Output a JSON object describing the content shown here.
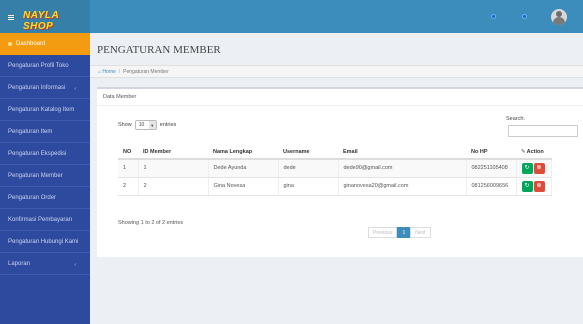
{
  "brand": {
    "logo_text": "NAYLA SHOP"
  },
  "sidebar": {
    "items": [
      {
        "label": "Dashboard",
        "active": true
      },
      {
        "label": "Pengaturan Profil Toko"
      },
      {
        "label": "Pengaturan Informasi",
        "caret": "‹"
      },
      {
        "label": "Pengaturan Katalog Item"
      },
      {
        "label": "Pengaturan Item"
      },
      {
        "label": "Pengaturan Ekspedisi"
      },
      {
        "label": "Pengaturan Member"
      },
      {
        "label": "Pengaturan Order"
      },
      {
        "label": "Konfirmasi Pembayaran"
      },
      {
        "label": "Pengaturan Hubungi Kami"
      },
      {
        "label": "Laporan",
        "caret": "‹"
      }
    ]
  },
  "page": {
    "title": "PENGATURAN MEMBER",
    "breadcrumb": {
      "home": "Home",
      "current": "Pengaturan Member"
    }
  },
  "box": {
    "header": "Data Member",
    "show_label": "Show",
    "entries_value": "10",
    "entries_label": "entries",
    "search_label": "Search:"
  },
  "table": {
    "columns": [
      "NO",
      "ID Member",
      "Nama Lengkap",
      "Username",
      "Email",
      "No HP",
      "Action"
    ],
    "rows": [
      {
        "no": "1",
        "id": "1",
        "nama": "Dede Ayunda",
        "username": "dede",
        "email": "dede90@gmail.com",
        "hp": "082251105408"
      },
      {
        "no": "2",
        "id": "2",
        "nama": "Gina Novesa",
        "username": "gina",
        "email": "ginanovesa20@gmail.com",
        "hp": "081256009656"
      }
    ]
  },
  "info": "Showing 1 to 2 of 2 entries",
  "pager": {
    "previous": "Previous",
    "page": "1",
    "next": "Next"
  }
}
